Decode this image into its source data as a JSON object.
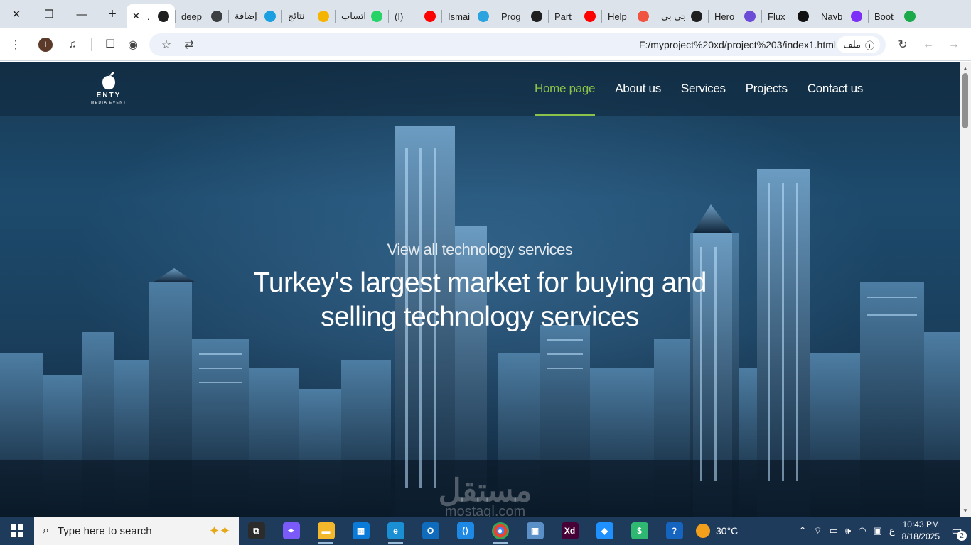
{
  "browser": {
    "tabs": [
      {
        "label": ".",
        "icon": "globe-icon",
        "color": "#1f1f1f",
        "active": true
      },
      {
        "label": "deep",
        "icon": "globe-icon",
        "color": "#3c4043"
      },
      {
        "label": "إضافة",
        "icon": "blue-circle-icon",
        "color": "#1a9fe0"
      },
      {
        "label": "نتائج",
        "icon": "five-icon",
        "color": "#f4b400"
      },
      {
        "label": "واتساب",
        "icon": "whatsapp-icon",
        "color": "#25d366"
      },
      {
        "label": "(I)",
        "icon": "youtube-icon",
        "color": "#ff0000"
      },
      {
        "label": "Ismai",
        "icon": "telegram-icon",
        "color": "#2aa3df"
      },
      {
        "label": "Prog",
        "icon": "p-icon",
        "color": "#1f1f1f"
      },
      {
        "label": "Part",
        "icon": "youtube-icon",
        "color": "#ff0000"
      },
      {
        "label": "Help",
        "icon": "laravel-icon",
        "color": "#f05340"
      },
      {
        "label": "جي بي",
        "icon": "openai-icon",
        "color": "#1f1f1f"
      },
      {
        "label": "Hero",
        "icon": "shield-icon",
        "color": "#6c4cd6"
      },
      {
        "label": "Flux",
        "icon": "wave-icon",
        "color": "#111111"
      },
      {
        "label": "Navb",
        "icon": "bootstrap-icon",
        "color": "#7b2ff7"
      },
      {
        "label": "Boot",
        "icon": "w-icon",
        "color": "#1ca94a"
      }
    ],
    "url": "F:/myproject%20xd/project%203/index1.html",
    "file_chip": "ملف",
    "profile_initial": "I"
  },
  "site": {
    "logo_text": "ENTY",
    "logo_sub": "MEDIA EVENT",
    "nav": [
      {
        "label": "Home page",
        "active": true
      },
      {
        "label": "About us"
      },
      {
        "label": "Services"
      },
      {
        "label": "Projects"
      },
      {
        "label": "Contact us"
      }
    ],
    "hero_subtitle": "View all technology services",
    "hero_title_line1": "Turkey's largest market for buying and",
    "hero_title_line2": "selling technology services",
    "accent_color": "#8bc34a"
  },
  "watermark": {
    "main": "مستقل",
    "sub": "mostaql.com"
  },
  "taskbar": {
    "search_placeholder": "Type here to search",
    "weather": "30°C",
    "time": "10:43 PM",
    "date": "8/18/2025",
    "lang": "ع",
    "notifications": "2",
    "apps": [
      {
        "name": "task-view",
        "label": "⧉"
      },
      {
        "name": "copilot",
        "label": "✦"
      },
      {
        "name": "file-explorer",
        "label": "▬"
      },
      {
        "name": "microsoft-store",
        "label": "▦"
      },
      {
        "name": "edge",
        "label": "e"
      },
      {
        "name": "outlook",
        "label": "O"
      },
      {
        "name": "vscode",
        "label": "⟨⟩"
      },
      {
        "name": "chrome",
        "label": "●"
      },
      {
        "name": "remote-desktop",
        "label": "▣"
      },
      {
        "name": "adobe-xd",
        "label": "Xd"
      },
      {
        "name": "app-blue",
        "label": "◆"
      },
      {
        "name": "app-coins",
        "label": "$"
      },
      {
        "name": "help",
        "label": "?"
      }
    ]
  }
}
